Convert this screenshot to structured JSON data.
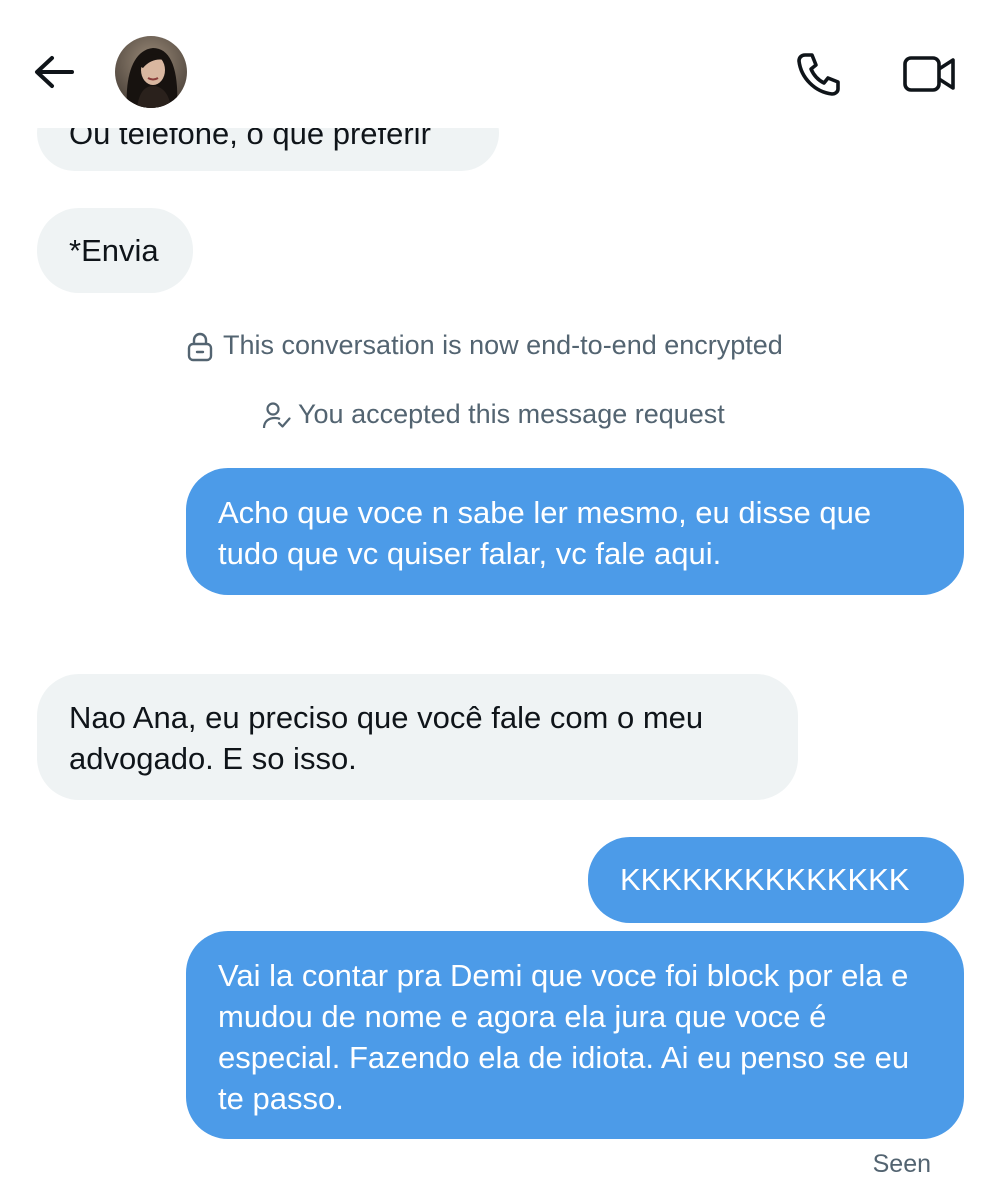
{
  "header": {
    "back_icon": "arrow-left-icon",
    "avatar_icon": "profile-avatar",
    "call_icon": "phone-icon",
    "video_icon": "video-camera-icon"
  },
  "messages": [
    {
      "direction": "incoming",
      "text": "Ou telefone, o que preferir"
    },
    {
      "direction": "incoming",
      "text": "*Envia"
    },
    {
      "direction": "outgoing",
      "text": "Acho que voce n sabe ler mesmo, eu disse que tudo que vc quiser falar, vc fale aqui."
    },
    {
      "direction": "incoming",
      "text": "Nao Ana, eu preciso que você fale com o meu advogado. E so isso."
    },
    {
      "direction": "outgoing",
      "text": "KKKKKKKKKKKKKK"
    },
    {
      "direction": "outgoing",
      "text": "Vai la contar pra Demi que voce foi block por ela e mudou de nome e agora ela jura que voce é especial. Fazendo ela de idiota. Ai eu penso se eu te passo."
    }
  ],
  "system_notices": {
    "encrypted": "This conversation is now end-to-end encrypted",
    "accepted": "You accepted this message request"
  },
  "status": {
    "seen": "Seen"
  },
  "colors": {
    "outgoing_bubble": "#4c9be8",
    "incoming_bubble": "#eff3f4",
    "secondary_text": "#536471"
  }
}
